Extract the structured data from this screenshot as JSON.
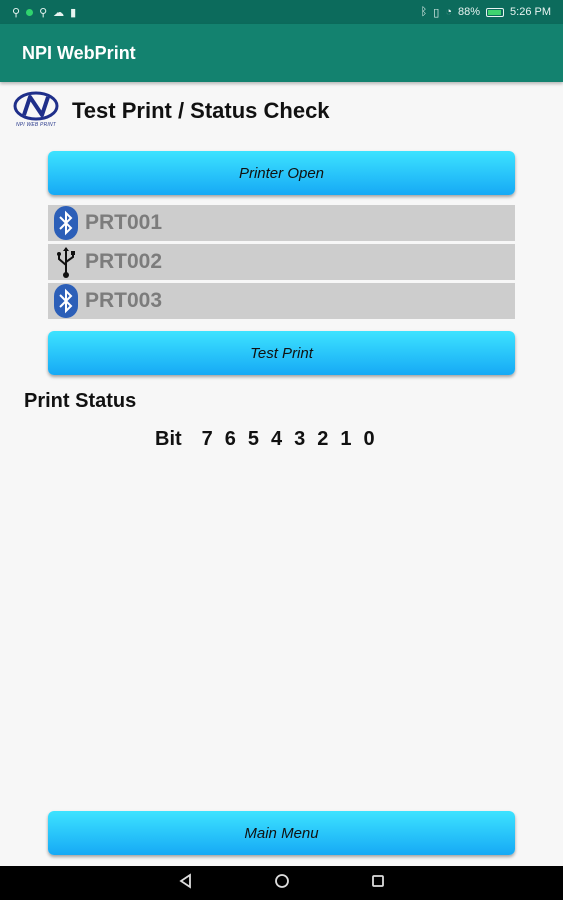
{
  "status_bar": {
    "battery_percent": "88%",
    "time": "5:26 PM"
  },
  "app_bar": {
    "title": "NPI WebPrint"
  },
  "header": {
    "logo_text": "NPI WEB PRINT",
    "title": "Test Print / Status Check"
  },
  "buttons": {
    "printer_open": "Printer Open",
    "test_print": "Test Print",
    "main_menu": "Main Menu"
  },
  "printers": [
    {
      "label": "PRT001",
      "icon": "bluetooth-icon"
    },
    {
      "label": "PRT002",
      "icon": "usb-icon"
    },
    {
      "label": "PRT003",
      "icon": "bluetooth-icon"
    }
  ],
  "print_status": {
    "title": "Print Status",
    "bit_label": "Bit",
    "bits": [
      "7",
      "6",
      "5",
      "4",
      "3",
      "2",
      "1",
      "0"
    ]
  },
  "colors": {
    "app_bar": "#13826f",
    "status_bar": "#0c6b5c",
    "button_gradient_top": "#3de3ff",
    "button_gradient_bottom": "#16a9f5",
    "bluetooth": "#2c5fb8",
    "list_bg": "#cdcdcd"
  }
}
